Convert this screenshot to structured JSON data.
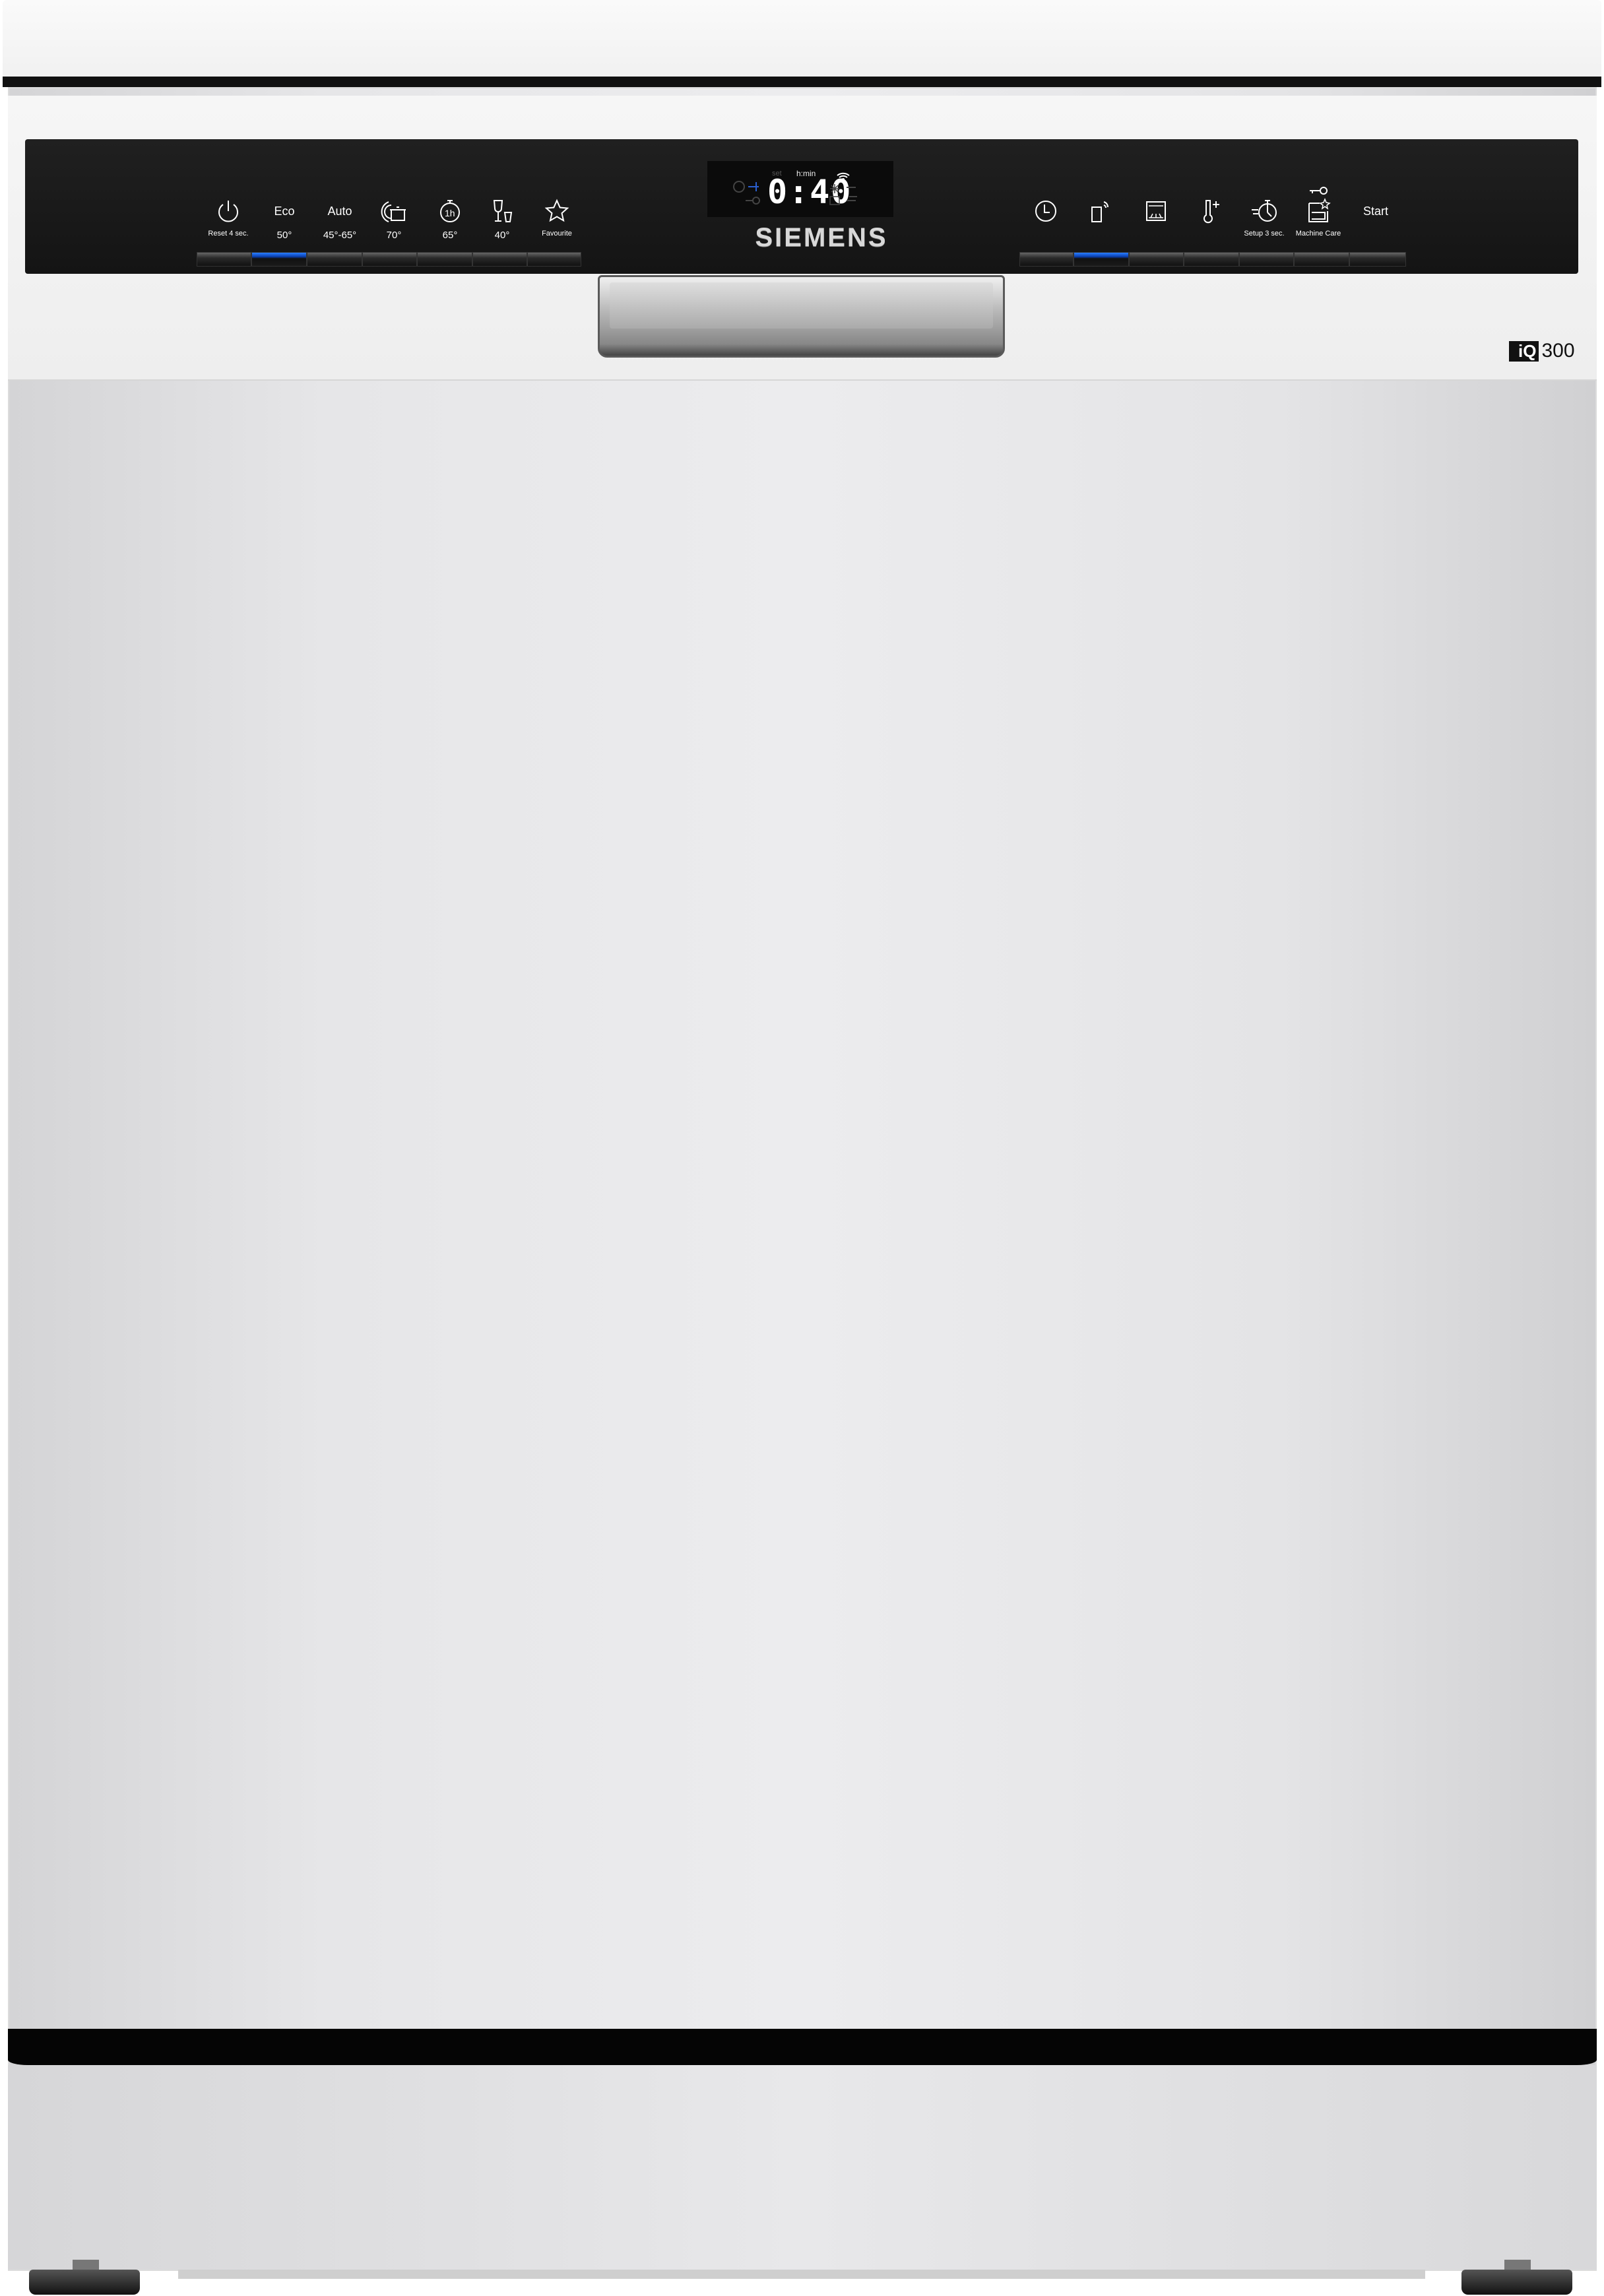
{
  "brand": "SIEMENS",
  "series": {
    "mark": "iQ",
    "number": "300"
  },
  "display": {
    "time": "0:40",
    "unit": "h:min",
    "set_label": "set",
    "indicators": [
      "clock-icon",
      "delay-end-icon",
      "key-icon",
      "wifi-icon",
      "rinse-aid-icon",
      "salt-icon",
      "machine-care-icon",
      "water-icon"
    ]
  },
  "left_buttons": [
    {
      "icon": "power-icon",
      "top": "",
      "sub": "Reset 4 sec."
    },
    {
      "icon": "",
      "top": "Eco",
      "sub": "50°",
      "active": true
    },
    {
      "icon": "",
      "top": "Auto",
      "sub": "45°-65°"
    },
    {
      "icon": "intensive-pot-icon",
      "top": "",
      "sub": "70°"
    },
    {
      "icon": "one-hour-timer-icon",
      "top": "",
      "sub": "65°"
    },
    {
      "icon": "glass-icon",
      "top": "",
      "sub": "40°"
    },
    {
      "icon": "star-icon",
      "top": "",
      "sub": "Favourite"
    }
  ],
  "right_buttons": [
    {
      "icon": "clock-icon",
      "top": "",
      "sub": ""
    },
    {
      "icon": "remote-start-icon",
      "top": "",
      "sub": "",
      "active": true
    },
    {
      "icon": "extra-dry-icon",
      "top": "",
      "sub": ""
    },
    {
      "icon": "hygiene-plus-icon",
      "top": "",
      "sub": ""
    },
    {
      "icon": "speed-icon",
      "top": "",
      "sub": "Setup 3 sec."
    },
    {
      "icon": "machine-care-icon",
      "top": "",
      "sub": "Machine Care"
    },
    {
      "icon": "",
      "top": "Start",
      "sub": ""
    }
  ],
  "colors": {
    "panel": "#181818",
    "active_led": "#1e6bff",
    "body": "#e6e6e8"
  }
}
